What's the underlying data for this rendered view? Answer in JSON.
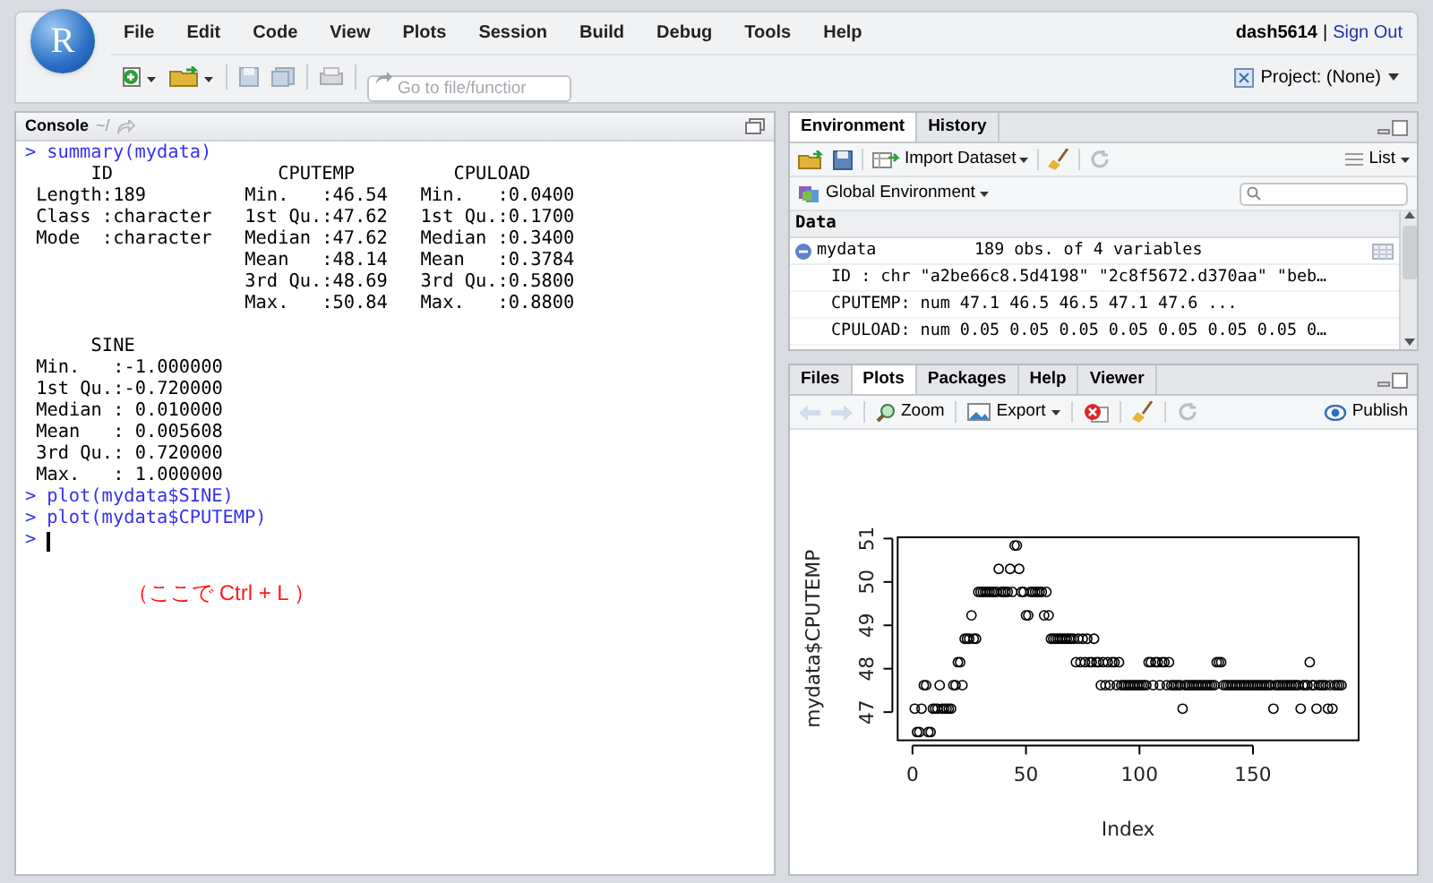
{
  "header": {
    "logo": "R",
    "menu": [
      "File",
      "Edit",
      "Code",
      "View",
      "Plots",
      "Session",
      "Build",
      "Debug",
      "Tools",
      "Help"
    ],
    "user": "dash5614",
    "separator": "|",
    "sign_out": "Sign Out",
    "goto_field": {
      "placeholder": "Go to file/functior"
    },
    "project": "Project: (None)"
  },
  "console": {
    "title": "Console",
    "path": "~/",
    "entries": [
      {
        "kind": "input",
        "prompt": ">",
        "text": "summary(mydata)"
      },
      {
        "kind": "output",
        "lines": [
          "      ID               CPUTEMP         CPULOAD",
          " Length:189         Min.   :46.54   Min.   :0.0400",
          " Class :character   1st Qu.:47.62   1st Qu.:0.1700",
          " Mode  :character   Median :47.62   Median :0.3400",
          "                    Mean   :48.14   Mean   :0.3784",
          "                    3rd Qu.:48.69   3rd Qu.:0.5800",
          "                    Max.   :50.84   Max.   :0.8800"
        ]
      },
      {
        "kind": "output",
        "lines": [
          "      SINE",
          " Min.   :-1.000000",
          " 1st Qu.:-0.720000",
          " Median : 0.010000",
          " Mean   : 0.005608",
          " 3rd Qu.: 0.720000",
          " Max.   : 1.000000"
        ]
      },
      {
        "kind": "input",
        "prompt": ">",
        "text": "plot(mydata$SINE)"
      },
      {
        "kind": "input",
        "prompt": ">",
        "text": "plot(mydata$CPUTEMP)"
      },
      {
        "kind": "prompt",
        "prompt": ">"
      }
    ],
    "annotation": "（ここで Ctrl + L ）"
  },
  "environment": {
    "tabs": [
      {
        "label": "Environment",
        "selected": true
      },
      {
        "label": "History",
        "selected": false
      }
    ],
    "import_button": "Import Dataset",
    "view_menu": "List",
    "scope": "Global Environment",
    "section": "Data",
    "objects": [
      {
        "name": "mydata",
        "value": "189 obs. of 4 variables",
        "expanded": true,
        "children": [
          "ID : chr \"a2be66c8.5d4198\" \"2c8f5672.d370aa\" \"beb…",
          "CPUTEMP: num 47.1 46.5 46.5 47.1 47.6 ...",
          "CPULOAD: num 0.05 0.05 0.05 0.05 0.05 0.05 0.05 0…"
        ]
      }
    ]
  },
  "plots": {
    "tabs": [
      {
        "label": "Files",
        "selected": false
      },
      {
        "label": "Plots",
        "selected": true
      },
      {
        "label": "Packages",
        "selected": false
      },
      {
        "label": "Help",
        "selected": false
      },
      {
        "label": "Viewer",
        "selected": false
      }
    ],
    "zoom_button": "Zoom",
    "export_button": "Export",
    "publish_button": "Publish",
    "chart_data": {
      "type": "scatter",
      "xlabel": "Index",
      "ylabel": "mydata$CPUTEMP",
      "xlim": [
        -6.52,
        196.52
      ],
      "ylim": [
        46.35,
        51.03
      ],
      "xticks": [
        0,
        50,
        100,
        150
      ],
      "yticks": [
        47,
        48,
        49,
        50,
        51
      ],
      "x": [
        1,
        2,
        3,
        4,
        5,
        6,
        7,
        8,
        9,
        10,
        11,
        12,
        13,
        14,
        15,
        16,
        17,
        18,
        19,
        20,
        21,
        22,
        23,
        24,
        25,
        26,
        27,
        28,
        29,
        30,
        31,
        32,
        33,
        34,
        35,
        36,
        37,
        38,
        39,
        40,
        41,
        42,
        43,
        44,
        45,
        46,
        47,
        48,
        49,
        50,
        51,
        52,
        53,
        54,
        55,
        56,
        57,
        58,
        59,
        60,
        61,
        62,
        63,
        64,
        65,
        66,
        67,
        68,
        69,
        70,
        71,
        72,
        73,
        74,
        75,
        76,
        77,
        78,
        79,
        80,
        81,
        82,
        83,
        84,
        85,
        86,
        87,
        88,
        89,
        90,
        91,
        92,
        93,
        94,
        95,
        96,
        97,
        98,
        99,
        100,
        101,
        102,
        103,
        104,
        105,
        106,
        107,
        108,
        109,
        110,
        111,
        112,
        113,
        114,
        115,
        116,
        117,
        118,
        119,
        120,
        121,
        122,
        123,
        124,
        125,
        126,
        127,
        128,
        129,
        130,
        131,
        132,
        133,
        134,
        135,
        136,
        137,
        138,
        139,
        140,
        141,
        142,
        143,
        144,
        145,
        146,
        147,
        148,
        149,
        150,
        151,
        152,
        153,
        154,
        155,
        156,
        157,
        158,
        159,
        160,
        161,
        162,
        163,
        164,
        165,
        166,
        167,
        168,
        169,
        170,
        171,
        172,
        173,
        174,
        175,
        176,
        177,
        178,
        179,
        180,
        181,
        182,
        183,
        184,
        185,
        186,
        187,
        188,
        189
      ],
      "series": [
        {
          "color": "#000000",
          "values": [
            47.08,
            46.54,
            46.54,
            47.08,
            47.62,
            47.62,
            46.54,
            46.54,
            47.08,
            47.08,
            47.08,
            47.62,
            47.08,
            47.08,
            47.08,
            47.08,
            47.08,
            47.62,
            47.62,
            48.15,
            48.15,
            47.62,
            48.69,
            48.69,
            48.69,
            49.23,
            48.69,
            48.69,
            49.77,
            49.77,
            49.77,
            49.77,
            49.77,
            49.77,
            49.77,
            49.77,
            49.77,
            50.3,
            49.77,
            49.77,
            49.77,
            49.77,
            50.3,
            49.77,
            50.84,
            50.84,
            50.3,
            49.77,
            49.77,
            49.23,
            49.23,
            49.77,
            49.77,
            49.77,
            49.77,
            49.77,
            49.77,
            49.23,
            49.77,
            49.23,
            48.69,
            48.69,
            48.69,
            48.69,
            48.69,
            48.69,
            48.69,
            48.69,
            48.69,
            48.69,
            48.69,
            48.15,
            48.69,
            48.15,
            48.69,
            48.15,
            48.69,
            48.15,
            48.15,
            48.69,
            48.15,
            48.15,
            47.62,
            48.15,
            47.62,
            48.15,
            47.62,
            48.15,
            48.15,
            47.62,
            48.15,
            47.62,
            47.62,
            47.62,
            47.62,
            47.62,
            47.62,
            47.62,
            47.62,
            47.62,
            47.62,
            47.62,
            47.62,
            48.15,
            48.15,
            47.62,
            48.15,
            48.15,
            47.62,
            48.15,
            48.15,
            47.62,
            48.15,
            47.62,
            47.62,
            47.62,
            47.62,
            47.62,
            47.08,
            47.62,
            47.62,
            47.62,
            47.62,
            47.62,
            47.62,
            47.62,
            47.62,
            47.62,
            47.62,
            47.62,
            47.62,
            47.62,
            47.62,
            48.15,
            48.15,
            48.15,
            47.62,
            47.62,
            47.62,
            47.62,
            47.62,
            47.62,
            47.62,
            47.62,
            47.62,
            47.62,
            47.62,
            47.62,
            47.62,
            47.62,
            47.62,
            47.62,
            47.62,
            47.62,
            47.62,
            47.62,
            47.62,
            47.62,
            47.08,
            47.62,
            47.62,
            47.62,
            47.62,
            47.62,
            47.62,
            47.62,
            47.62,
            47.62,
            47.62,
            47.62,
            47.08,
            47.62,
            47.62,
            47.62,
            48.15,
            47.62,
            47.62,
            47.08,
            47.62,
            47.62,
            47.62,
            47.62,
            47.08,
            47.62,
            47.08,
            47.62,
            47.62,
            47.62,
            47.62
          ]
        }
      ]
    }
  }
}
